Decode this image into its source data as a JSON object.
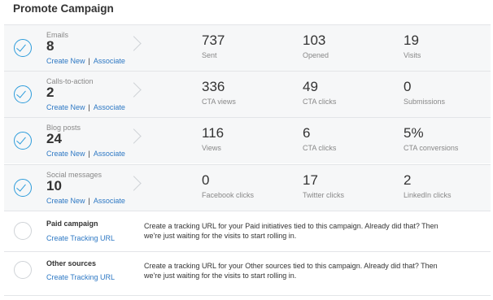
{
  "title": "Promote Campaign",
  "channels": [
    {
      "label": "Emails",
      "count": "8",
      "create": "Create New",
      "sep": "|",
      "associate": "Associate",
      "stats": [
        {
          "value": "737",
          "caption": "Sent"
        },
        {
          "value": "103",
          "caption": "Opened"
        },
        {
          "value": "19",
          "caption": "Visits"
        }
      ]
    },
    {
      "label": "Calls-to-action",
      "count": "2",
      "create": "Create New",
      "sep": "|",
      "associate": "Associate",
      "stats": [
        {
          "value": "336",
          "caption": "CTA views"
        },
        {
          "value": "49",
          "caption": "CTA clicks"
        },
        {
          "value": "0",
          "caption": "Submissions"
        }
      ]
    },
    {
      "label": "Blog posts",
      "count": "24",
      "create": "Create New",
      "sep": "|",
      "associate": "Associate",
      "stats": [
        {
          "value": "116",
          "caption": "Views"
        },
        {
          "value": "6",
          "caption": "CTA clicks"
        },
        {
          "value": "5%",
          "caption": "CTA conversions"
        }
      ]
    },
    {
      "label": "Social messages",
      "count": "10",
      "create": "Create New",
      "sep": "|",
      "associate": "Associate",
      "stats": [
        {
          "value": "0",
          "caption": "Facebook clicks"
        },
        {
          "value": "17",
          "caption": "Twitter clicks"
        },
        {
          "value": "2",
          "caption": "LinkedIn clicks"
        }
      ]
    }
  ],
  "sources": [
    {
      "title": "Paid campaign",
      "link": "Create Tracking URL",
      "desc": "Create a tracking URL for your Paid initiatives tied to this campaign. Already did that? Then we're just waiting for the visits to start rolling in."
    },
    {
      "title": "Other sources",
      "link": "Create Tracking URL",
      "desc": "Create a tracking URL for your Other sources tied to this campaign. Already did that? Then we're just waiting for the visits to start rolling in."
    }
  ],
  "colors": {
    "accent": "#2d9cdb",
    "link": "#2d78c4",
    "row_shade": "#f6f7f8"
  }
}
